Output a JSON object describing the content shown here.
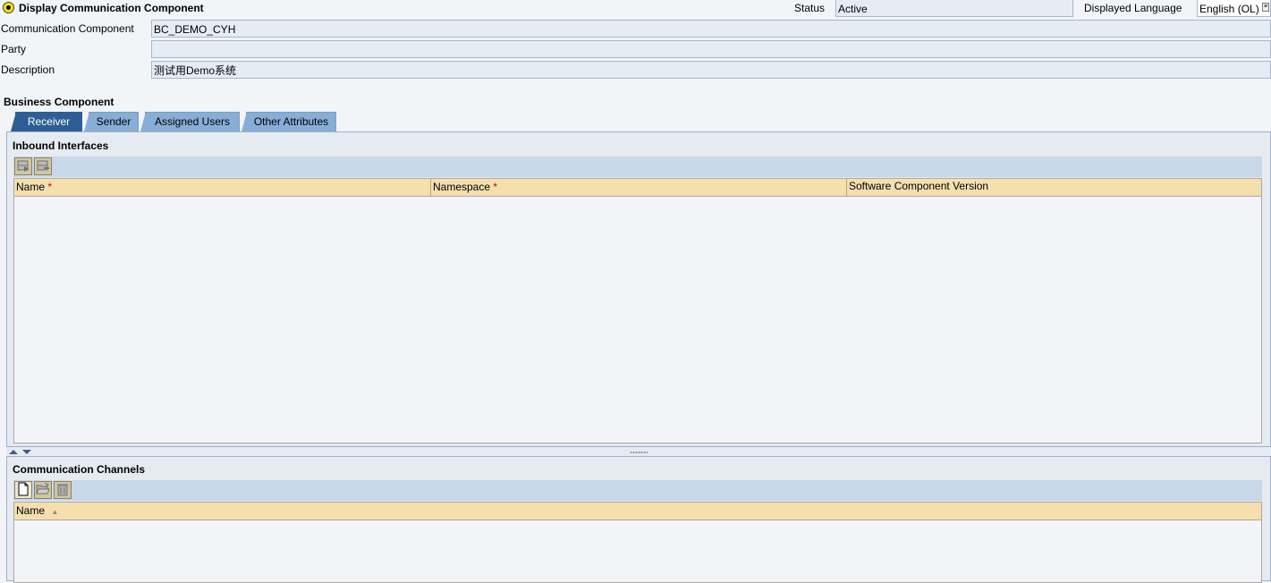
{
  "header": {
    "title": "Display Communication Component",
    "status_label": "Status",
    "status_value": "Active",
    "language_label": "Displayed Language",
    "language_value": "English (OL)"
  },
  "form": {
    "comm_component_label": "Communication Component",
    "comm_component_value": "BC_DEMO_CYH",
    "party_label": "Party",
    "party_value": "",
    "description_label": "Description",
    "description_value": "测试用Demo系统"
  },
  "business_component": {
    "title": "Business Component",
    "tabs": [
      {
        "label": "Receiver",
        "active": true
      },
      {
        "label": "Sender",
        "active": false
      },
      {
        "label": "Assigned Users",
        "active": false
      },
      {
        "label": "Other Attributes",
        "active": false
      }
    ]
  },
  "inbound": {
    "title": "Inbound Interfaces",
    "toolbar": [
      "insert-row-icon",
      "delete-row-icon"
    ],
    "columns": [
      {
        "label": "Name",
        "required": "*"
      },
      {
        "label": "Namespace",
        "required": "*"
      },
      {
        "label": "Software Component Version",
        "required": ""
      }
    ],
    "rows": []
  },
  "channels": {
    "title": "Communication Channels",
    "toolbar": [
      "new-document-icon",
      "open-folder-icon",
      "trash-icon"
    ],
    "columns": [
      {
        "label": "Name",
        "sort": "▲"
      }
    ],
    "rows": []
  },
  "colors": {
    "tab_active": "#2e5e94",
    "tab_inactive": "#87aed6",
    "table_header": "#f4dfad",
    "field_bg": "#e6ecf4",
    "required": "#cc0000"
  }
}
